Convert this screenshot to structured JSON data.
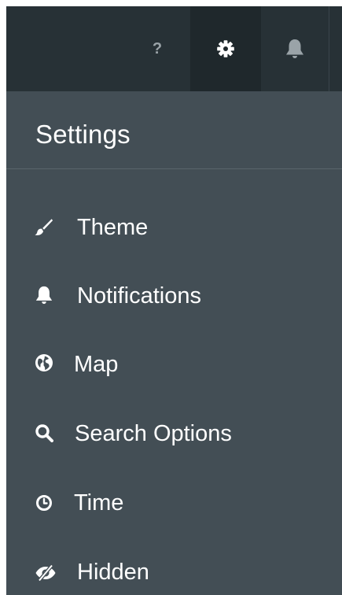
{
  "topbar": {
    "help_label": "?",
    "icons": [
      "help-icon",
      "gear-icon",
      "bell-icon"
    ],
    "active": "settings"
  },
  "header": {
    "title": "Settings"
  },
  "menu": {
    "items": [
      {
        "label": "Theme",
        "icon": "paintbrush-icon"
      },
      {
        "label": "Notifications",
        "icon": "bell-icon"
      },
      {
        "label": "Map",
        "icon": "globe-icon"
      },
      {
        "label": "Search Options",
        "icon": "search-icon"
      },
      {
        "label": "Time",
        "icon": "clock-icon"
      },
      {
        "label": "Hidden",
        "icon": "eye-slash-icon"
      }
    ]
  },
  "colors": {
    "panel": "#434e55",
    "topbar": "#273136",
    "active_tab": "#1f282c",
    "text": "#ffffff"
  }
}
